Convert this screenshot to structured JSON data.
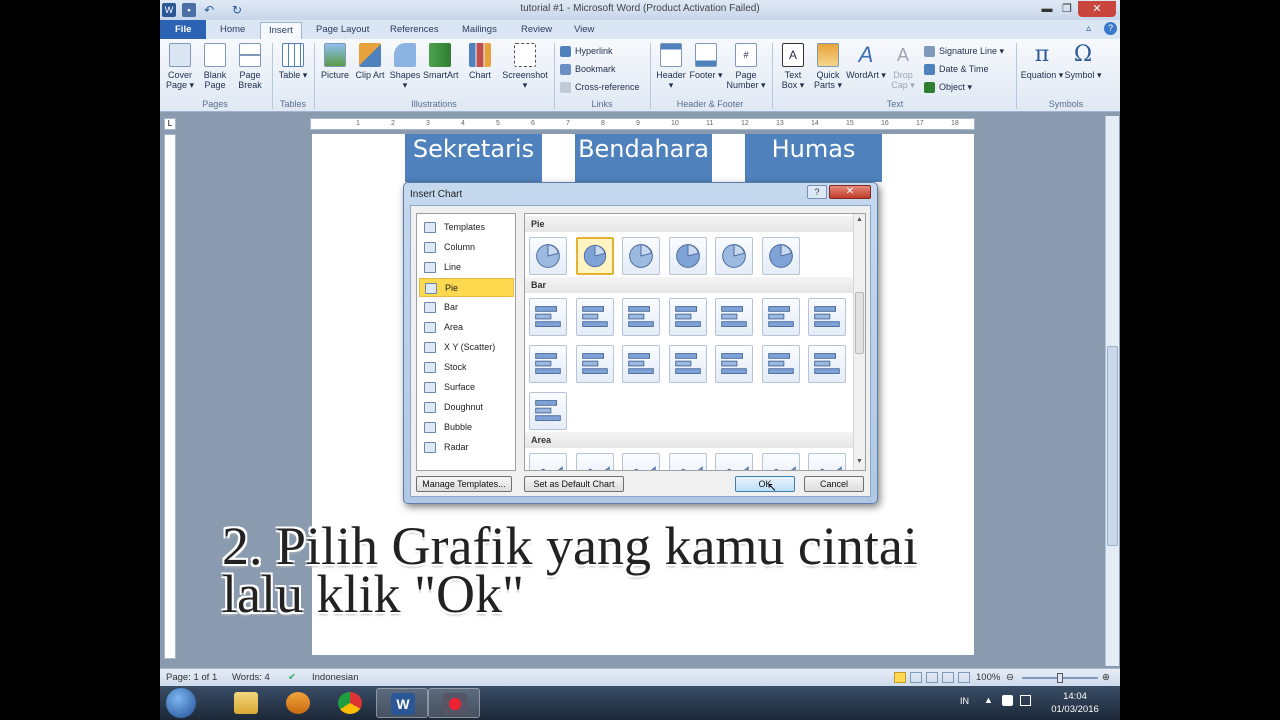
{
  "window": {
    "title": "tutorial #1  -  Microsoft Word (Product Activation Failed)",
    "min": "▬",
    "max": "❐",
    "close": "✕"
  },
  "tabs": [
    "File",
    "Home",
    "Insert",
    "Page Layout",
    "References",
    "Mailings",
    "Review",
    "View"
  ],
  "ribbon": {
    "pages": {
      "cover": "Cover Page ▾",
      "blank": "Blank Page",
      "break": "Page Break",
      "label": "Pages"
    },
    "tables": {
      "table": "Table ▾",
      "label": "Tables"
    },
    "illustrations": {
      "picture": "Picture",
      "clip": "Clip Art",
      "shapes": "Shapes ▾",
      "smartart": "SmartArt",
      "chart": "Chart",
      "screenshot": "Screenshot ▾",
      "label": "Illustrations"
    },
    "links": {
      "hyperlink": "Hyperlink",
      "bookmark": "Bookmark",
      "crossref": "Cross-reference",
      "label": "Links"
    },
    "hf": {
      "header": "Header ▾",
      "footer": "Footer ▾",
      "pagenum": "Page Number ▾",
      "label": "Header & Footer"
    },
    "text": {
      "textbox": "Text Box ▾",
      "quickparts": "Quick Parts ▾",
      "wordart": "WordArt ▾",
      "dropcap": "Drop Cap ▾",
      "sigline": "Signature Line ▾",
      "datetime": "Date & Time",
      "object": "Object ▾",
      "label": "Text"
    },
    "symbols": {
      "equation": "Equation ▾",
      "symbol": "Symbol ▾",
      "label": "Symbols"
    }
  },
  "document": {
    "headers": [
      "Sekretaris",
      "Bendahara",
      "Humas"
    ]
  },
  "dialog": {
    "title": "Insert Chart",
    "help": "?",
    "close": "✕",
    "categories": [
      "Templates",
      "Column",
      "Line",
      "Pie",
      "Bar",
      "Area",
      "X Y (Scatter)",
      "Stock",
      "Surface",
      "Doughnut",
      "Bubble",
      "Radar"
    ],
    "selected_category": "Pie",
    "sections": [
      "Pie",
      "Bar",
      "Area"
    ],
    "buttons": {
      "manage": "Manage Templates...",
      "setdefault": "Set as Default Chart",
      "ok": "OK",
      "cancel": "Cancel"
    }
  },
  "caption": {
    "line1": "2. Pilih Grafik yang kamu cintai",
    "line2": "lalu klik \"Ok\""
  },
  "status": {
    "page": "Page: 1 of 1",
    "words": "Words: 4",
    "language": "Indonesian",
    "zoom": "100%"
  },
  "taskbar": {
    "lang": "IN",
    "time": "14:04",
    "date": "01/03/2016"
  },
  "colors": {
    "accent": "#2b62b3",
    "table_header": "#4f81bd",
    "selection": "#fcd94f"
  }
}
